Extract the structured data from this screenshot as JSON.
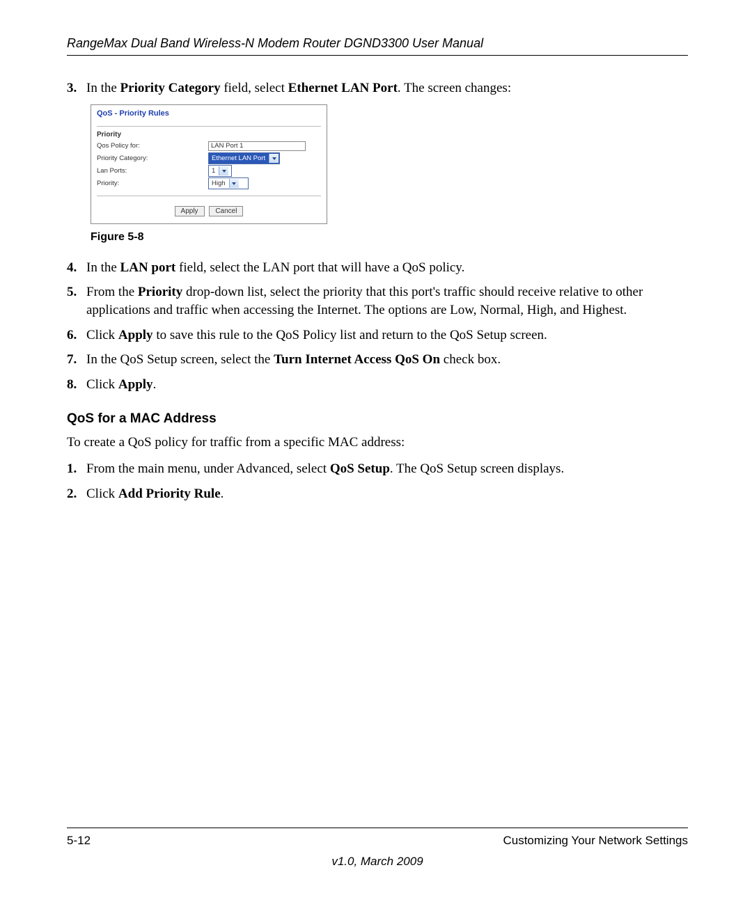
{
  "header": {
    "running_title": "RangeMax Dual Band Wireless-N Modem Router DGND3300 User Manual"
  },
  "steps_top": {
    "s3": {
      "num": "3.",
      "pre": "In the ",
      "b1": "Priority Category",
      "mid": " field, select ",
      "b2": "Ethernet LAN Port",
      "post": ". The screen changes:"
    }
  },
  "panel": {
    "title": "QoS - Priority Rules",
    "section": "Priority",
    "rows": {
      "policy_for": {
        "label": "Qos Policy for:",
        "value": "LAN Port 1"
      },
      "category": {
        "label": "Priority Category:",
        "value": "Ethernet LAN Port"
      },
      "lan_ports": {
        "label": "Lan Ports:",
        "value": "1"
      },
      "priority": {
        "label": "Priority:",
        "value": "High"
      }
    },
    "buttons": {
      "apply": "Apply",
      "cancel": "Cancel"
    }
  },
  "figure_caption": "Figure 5-8",
  "steps_bottom": {
    "s4": {
      "num": "4.",
      "pre": "In the ",
      "b1": "LAN port",
      "post": " field, select the LAN port that will have a QoS policy."
    },
    "s5": {
      "num": "5.",
      "pre": "From the ",
      "b1": "Priority",
      "post": " drop-down list, select the priority that this port's traffic should receive relative to other applications and traffic when accessing the Internet. The options are Low, Normal, High, and Highest."
    },
    "s6": {
      "num": "6.",
      "pre": "Click ",
      "b1": "Apply",
      "post": " to save this rule to the QoS Policy list and return to the QoS Setup screen."
    },
    "s7": {
      "num": "7.",
      "pre": "In the QoS Setup screen, select the ",
      "b1": "Turn Internet Access QoS On",
      "post": " check box."
    },
    "s8": {
      "num": "8.",
      "pre": "Click ",
      "b1": "Apply",
      "post": "."
    }
  },
  "subheading": "QoS for a MAC Address",
  "intro2": "To create a QoS policy for traffic from a specific MAC address:",
  "steps2": {
    "s1": {
      "num": "1.",
      "pre": "From the main menu, under Advanced, select ",
      "b1": "QoS Setup",
      "post": ". The QoS Setup screen displays."
    },
    "s2": {
      "num": "2.",
      "pre": "Click ",
      "b1": "Add Priority Rule",
      "post": "."
    }
  },
  "footer": {
    "page_num": "5-12",
    "section": "Customizing Your Network Settings",
    "version": "v1.0, March 2009"
  }
}
